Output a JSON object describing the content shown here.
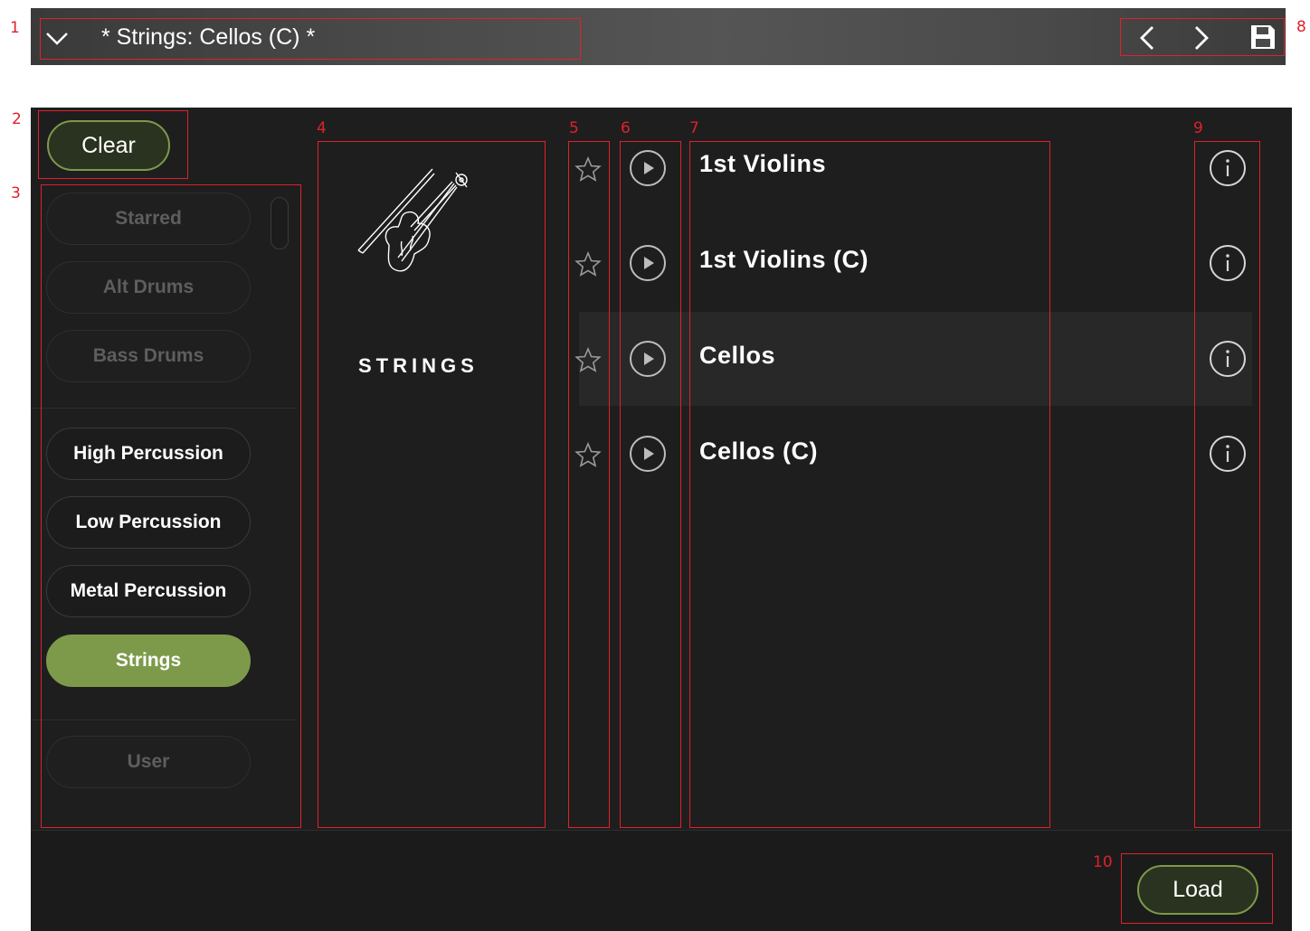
{
  "header": {
    "title": "* Strings: Cellos (C) *",
    "icons": [
      "chevron-down-icon",
      "arrow-left-icon",
      "arrow-right-icon",
      "save-icon"
    ]
  },
  "buttons": {
    "clear": "Clear",
    "load": "Load"
  },
  "categories": [
    {
      "label": "Starred",
      "state": "disabled"
    },
    {
      "label": "Alt Drums",
      "state": "disabled"
    },
    {
      "label": "Bass Drums",
      "state": "disabled"
    },
    {
      "label": "High Percussion",
      "state": "normal"
    },
    {
      "label": "Low Percussion",
      "state": "normal"
    },
    {
      "label": "Metal Percussion",
      "state": "normal"
    },
    {
      "label": "Strings",
      "state": "selected"
    },
    {
      "label": "User",
      "state": "disabled"
    }
  ],
  "category_panel": {
    "label": "STRINGS",
    "icon": "violin-icon"
  },
  "presets": [
    {
      "name": "1st Violins",
      "highlighted": false
    },
    {
      "name": "1st Violins (C)",
      "highlighted": false
    },
    {
      "name": "Cellos",
      "highlighted": true
    },
    {
      "name": "Cellos (C)",
      "highlighted": false
    }
  ],
  "callouts": [
    "1",
    "2",
    "3",
    "4",
    "5",
    "6",
    "7",
    "8",
    "9",
    "10"
  ],
  "colors": {
    "accent_green": "#7d9a4a",
    "callout_red": "#e0212b",
    "panel_bg": "#1e1e1e"
  }
}
